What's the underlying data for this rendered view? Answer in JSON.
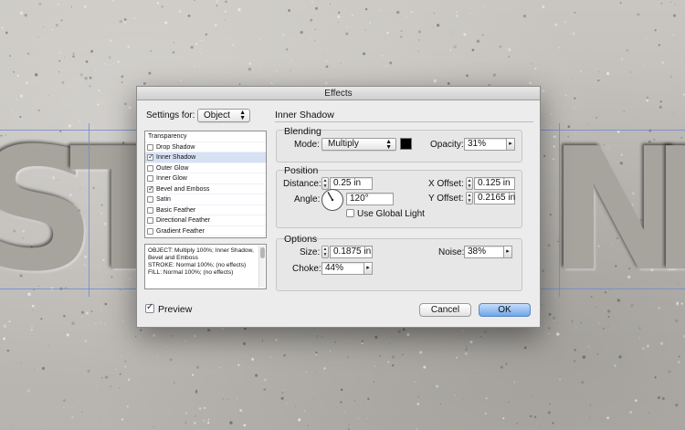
{
  "background": {
    "letters": [
      "S",
      "T",
      "N",
      "E"
    ]
  },
  "dialog": {
    "title": "Effects",
    "settings_for_label": "Settings for:",
    "settings_for_value": "Object",
    "effects": [
      {
        "label": "Transparency",
        "checkbox": false,
        "checked": false,
        "selected": false
      },
      {
        "label": "Drop Shadow",
        "checkbox": true,
        "checked": false,
        "selected": false
      },
      {
        "label": "Inner Shadow",
        "checkbox": true,
        "checked": true,
        "selected": true
      },
      {
        "label": "Outer Glow",
        "checkbox": true,
        "checked": false,
        "selected": false
      },
      {
        "label": "Inner Glow",
        "checkbox": true,
        "checked": false,
        "selected": false
      },
      {
        "label": "Bevel and Emboss",
        "checkbox": true,
        "checked": true,
        "selected": false
      },
      {
        "label": "Satin",
        "checkbox": true,
        "checked": false,
        "selected": false
      },
      {
        "label": "Basic Feather",
        "checkbox": true,
        "checked": false,
        "selected": false
      },
      {
        "label": "Directional Feather",
        "checkbox": true,
        "checked": false,
        "selected": false
      },
      {
        "label": "Gradient Feather",
        "checkbox": true,
        "checked": false,
        "selected": false
      }
    ],
    "summary_lines": [
      "OBJECT: Multiply 100%; Inner Shadow,",
      "Bevel and Emboss",
      "STROKE: Normal 100%; (no effects)",
      "FILL: Normal 100%; (no effects)"
    ],
    "preview_label": "Preview",
    "preview_checked": true,
    "section_title": "Inner Shadow",
    "blending": {
      "title": "Blending",
      "mode_label": "Mode:",
      "mode_value": "Multiply",
      "swatch_color": "#000000",
      "opacity_label": "Opacity:",
      "opacity_value": "31%"
    },
    "position": {
      "title": "Position",
      "distance_label": "Distance:",
      "distance_value": "0.25 in",
      "angle_label": "Angle:",
      "angle_value": "120°",
      "angle_degrees": 120,
      "global_light_label": "Use Global Light",
      "global_light_checked": false,
      "x_offset_label": "X Offset:",
      "x_offset_value": "0.125 in",
      "y_offset_label": "Y Offset:",
      "y_offset_value": "0.2165 in"
    },
    "options": {
      "title": "Options",
      "size_label": "Size:",
      "size_value": "0.1875 in",
      "choke_label": "Choke:",
      "choke_value": "44%",
      "noise_label": "Noise:",
      "noise_value": "38%"
    },
    "cancel_label": "Cancel",
    "ok_label": "OK"
  }
}
